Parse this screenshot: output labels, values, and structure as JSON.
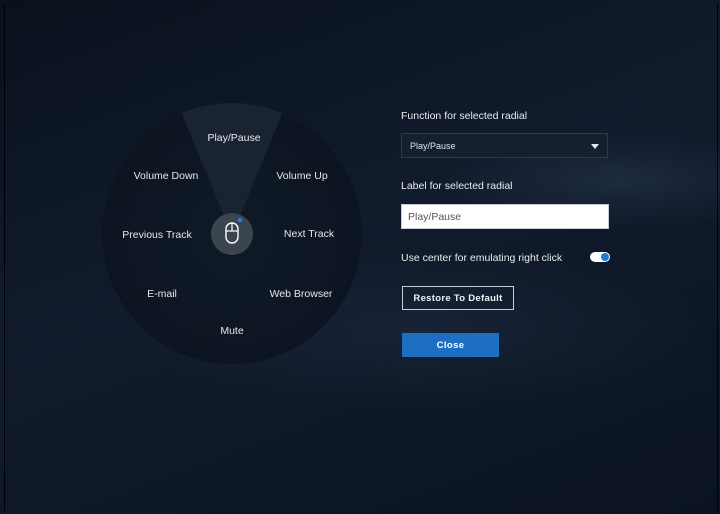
{
  "radial": {
    "center_icon": "mouse-icon",
    "segments": [
      {
        "label": "Play/Pause",
        "selected": true
      },
      {
        "label": "Volume Up",
        "selected": false
      },
      {
        "label": "Next Track",
        "selected": false
      },
      {
        "label": "Web Browser",
        "selected": false
      },
      {
        "label": "Mute",
        "selected": false
      },
      {
        "label": "E-mail",
        "selected": false
      },
      {
        "label": "Previous Track",
        "selected": false
      },
      {
        "label": "Volume Down",
        "selected": false
      }
    ]
  },
  "settings": {
    "function_label": "Function for selected radial",
    "function_value": "Play/Pause",
    "name_label": "Label for selected radial",
    "name_value": "Play/Pause",
    "center_toggle_label": "Use center for emulating right click",
    "center_toggle_on": true,
    "restore_button": "Restore To Default",
    "close_button": "Close"
  },
  "colors": {
    "accent": "#1d6fc4",
    "toggle_knob": "#1f7ad6",
    "background": "#0c1422"
  }
}
